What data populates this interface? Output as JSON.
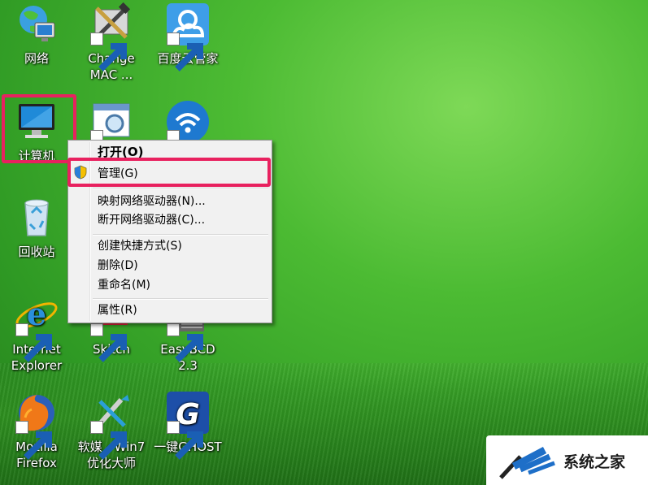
{
  "desktop": {
    "icons": [
      {
        "id": "network",
        "label": "网络"
      },
      {
        "id": "change-mac",
        "label": "Change\nMAC ..."
      },
      {
        "id": "baidu-cloud",
        "label": "百度云管家"
      },
      {
        "id": "computer",
        "label": "计算机"
      },
      {
        "id": "recycle-bin",
        "label": "回收站"
      },
      {
        "id": "ie",
        "label": "Internet\nExplorer"
      },
      {
        "id": "skitch",
        "label": "Skitch"
      },
      {
        "id": "easybcd",
        "label": "EasyBCD\n2.3"
      },
      {
        "id": "firefox",
        "label": "Mozilla\nFirefox"
      },
      {
        "id": "win7-optimizer",
        "label": "软媒 - Win7\n优化大师"
      },
      {
        "id": "ghost",
        "label": "一键GHOST"
      }
    ]
  },
  "context_menu": {
    "items": [
      {
        "label": "打开(O)"
      },
      {
        "label": "管理(G)"
      },
      {
        "label": "映射网络驱动器(N)..."
      },
      {
        "label": "断开网络驱动器(C)..."
      },
      {
        "label": "创建快捷方式(S)"
      },
      {
        "label": "删除(D)"
      },
      {
        "label": "重命名(M)"
      },
      {
        "label": "属性(R)"
      }
    ]
  },
  "watermark": {
    "text": "系统之家"
  },
  "colors": {
    "highlight": "#e8215f",
    "desktop_green": "#4cbb33",
    "menu_bg": "#f1f1f1"
  }
}
